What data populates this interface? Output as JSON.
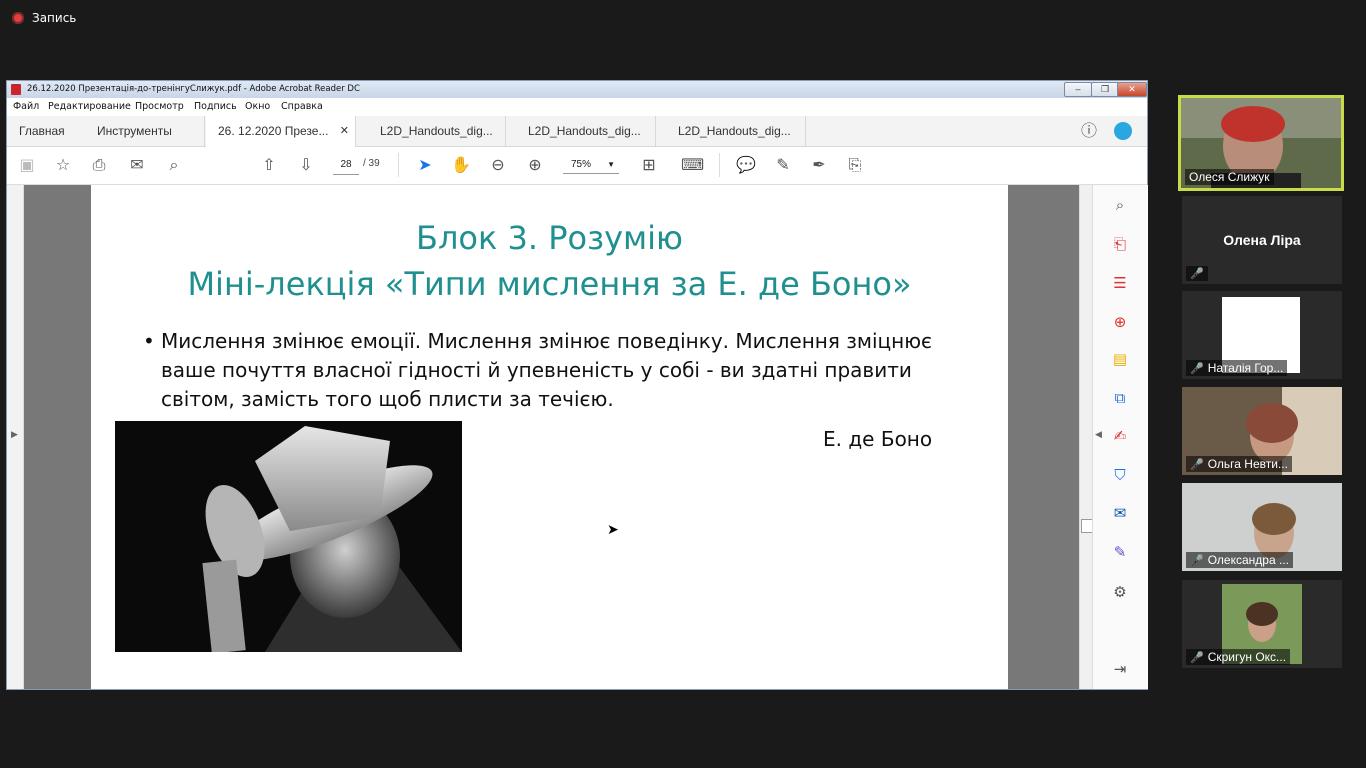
{
  "recording": {
    "label": "Запись"
  },
  "window": {
    "title": "26.12.2020 Презентація-до-тренінгуСлижук.pdf - Adobe Acrobat Reader DC",
    "menu": [
      "Файл",
      "Редактирование",
      "Просмотр",
      "Подпись",
      "Окно",
      "Справка"
    ]
  },
  "tabs": {
    "home": "Главная",
    "tools": "Инструменты",
    "docs": [
      "26. 12.2020 Презе...",
      "L2D_Handouts_dig...",
      "L2D_Handouts_dig...",
      "L2D_Handouts_dig..."
    ]
  },
  "toolbar": {
    "page_current": "28",
    "page_total": "/ 39",
    "zoom": "75%"
  },
  "slide": {
    "title_line1": "Блок 3. Розумію",
    "title_line2": "Міні-лекція «Типи мислення за Е. де Боно»",
    "bullet_char": "•",
    "body": "Мислення змінює емоції. Мислення змінює поведінку. Мислення зміцнює ваше почуття власної гідності й упевненість у собі - ви здатні правити світом, замість того щоб плисти за течією.",
    "author": "Е. де Боно"
  },
  "participants": [
    {
      "name": "Олеся Слижук",
      "active": true
    },
    {
      "name": "Олена Ліра"
    },
    {
      "name": "Наталія Гор..."
    },
    {
      "name": "Ольга Невти..."
    },
    {
      "name": "Олександра ..."
    },
    {
      "name": "Скригун Окс..."
    }
  ],
  "colors": {
    "title_teal": "#1f8f8f",
    "active_border": "#c8dc4a",
    "muted_mic": "#e33333"
  }
}
